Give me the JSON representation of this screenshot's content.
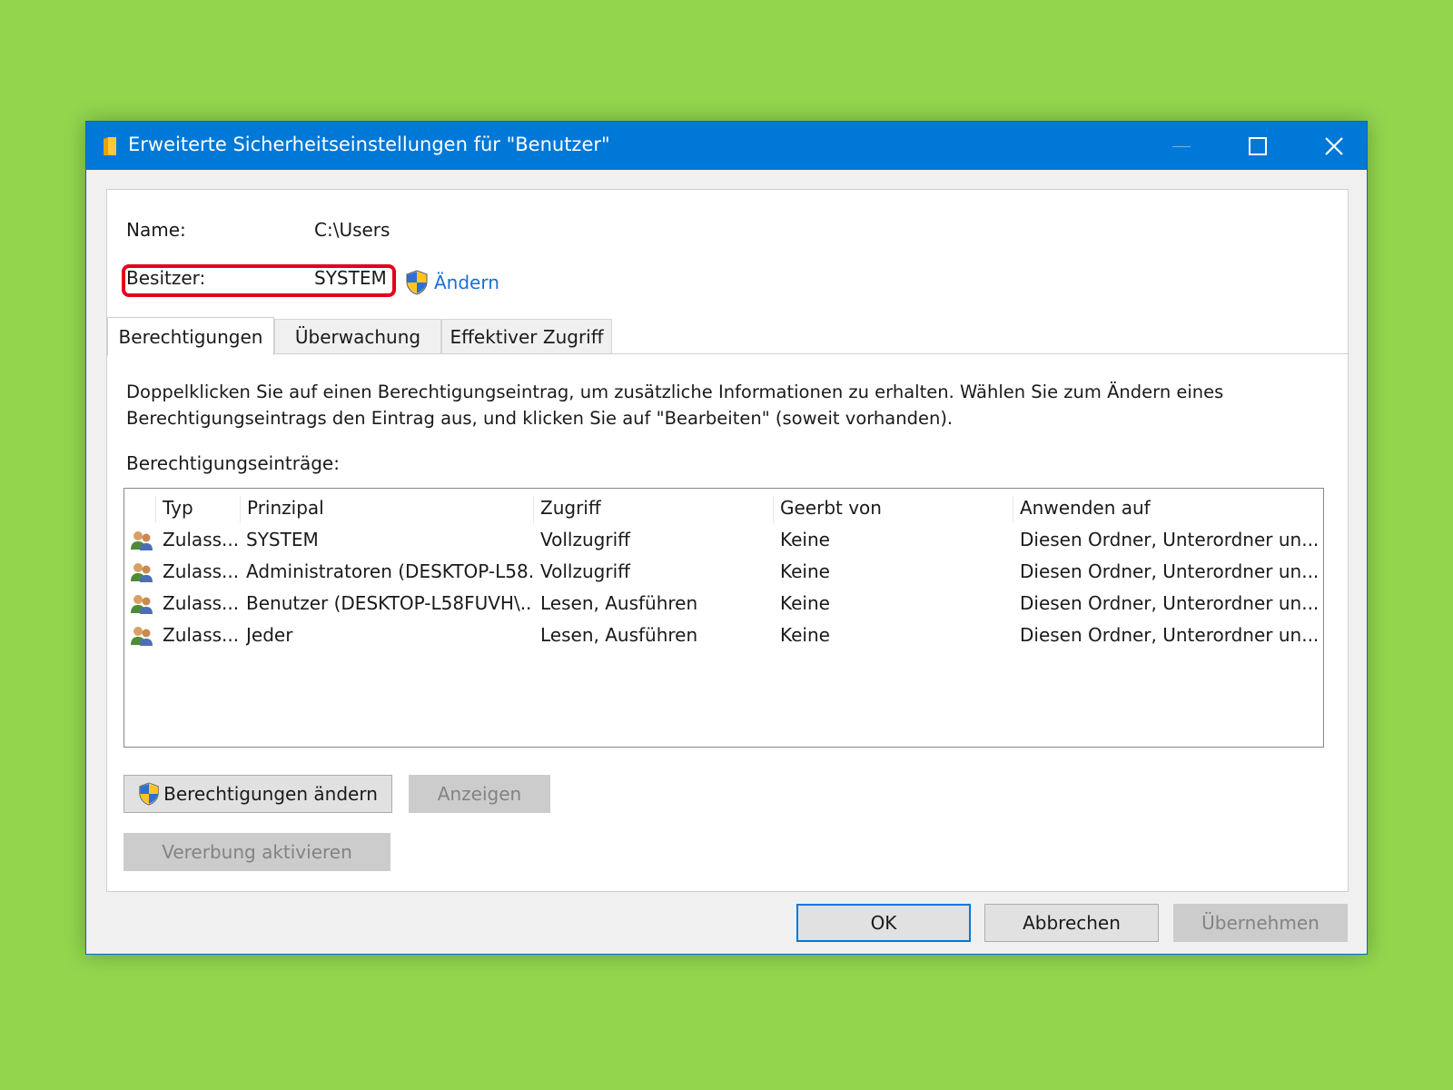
{
  "window": {
    "title": "Erweiterte Sicherheitseinstellungen für \"Benutzer\""
  },
  "info": {
    "name_label": "Name:",
    "name_value": "C:\\Users",
    "owner_label": "Besitzer:",
    "owner_value": "SYSTEM",
    "change_link": "Ändern"
  },
  "tabs": [
    {
      "label": "Berechtigungen",
      "active": true
    },
    {
      "label": "Überwachung",
      "active": false
    },
    {
      "label": "Effektiver Zugriff",
      "active": false
    }
  ],
  "description_line1": "Doppelklicken Sie auf einen Berechtigungseintrag, um zusätzliche Informationen zu erhalten. Wählen Sie zum Ändern eines",
  "description_line2": "Berechtigungseintrags den Eintrag aus, und klicken Sie auf \"Bearbeiten\" (soweit vorhanden).",
  "entries_label": "Berechtigungseinträge:",
  "table": {
    "columns": [
      "Typ",
      "Prinzipal",
      "Zugriff",
      "Geerbt von",
      "Anwenden auf"
    ],
    "rows": [
      [
        "Zulass...",
        "SYSTEM",
        "Vollzugriff",
        "Keine",
        "Diesen Ordner, Unterordner un..."
      ],
      [
        "Zulass...",
        "Administratoren (DESKTOP-L58...",
        "Vollzugriff",
        "Keine",
        "Diesen Ordner, Unterordner un..."
      ],
      [
        "Zulass...",
        "Benutzer (DESKTOP-L58FUVH\\...",
        "Lesen, Ausführen",
        "Keine",
        "Diesen Ordner, Unterordner un..."
      ],
      [
        "Zulass...",
        "Jeder",
        "Lesen, Ausführen",
        "Keine",
        "Diesen Ordner, Unterordner un..."
      ]
    ]
  },
  "buttons": {
    "change_permissions": "Berechtigungen ändern",
    "show": "Anzeigen",
    "enable_inheritance": "Vererbung aktivieren",
    "ok": "OK",
    "cancel": "Abbrechen",
    "apply": "Übernehmen"
  },
  "colors": {
    "background": "#92d64e",
    "titlebar": "#0078d7",
    "highlight": "#e4001b",
    "link": "#1a6fd6"
  }
}
